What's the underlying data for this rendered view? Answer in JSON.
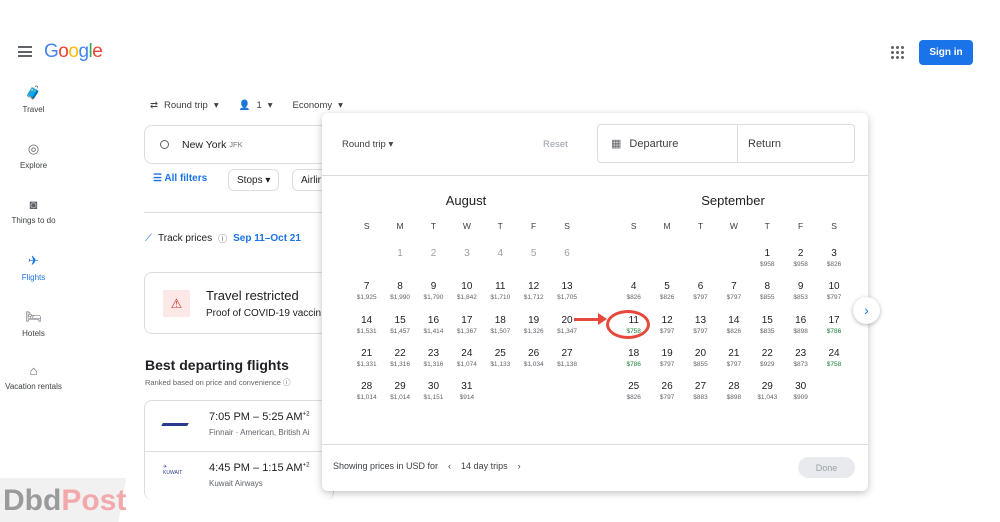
{
  "header": {
    "logo": "Google",
    "signin": "Sign in"
  },
  "nav": [
    {
      "label": "Travel",
      "icon": "luggage-icon"
    },
    {
      "label": "Explore",
      "icon": "explore-icon"
    },
    {
      "label": "Things to do",
      "icon": "camera-icon"
    },
    {
      "label": "Flights",
      "icon": "flight-icon",
      "active": true
    },
    {
      "label": "Hotels",
      "icon": "hotel-icon"
    },
    {
      "label": "Vacation rentals",
      "icon": "house-icon"
    }
  ],
  "search": {
    "trip_type": "Round trip",
    "passengers": "1",
    "cabin": "Economy",
    "origin": "New York",
    "origin_code": "JFK",
    "all_filters": "All filters",
    "stops": "Stops",
    "airlines": "Airlir"
  },
  "track": {
    "label": "Track prices",
    "dates": "Sep 11–Oct 21"
  },
  "restriction": {
    "title": "Travel restricted",
    "text": "Proof of COVID-19 vaccin"
  },
  "best": {
    "title": "Best departing flights",
    "subtitle": "Ranked based on price and convenience"
  },
  "flights": [
    {
      "times": "7:05 PM – 5:25 AM",
      "plus": "+2",
      "airline": "Finnair · American, British Ai"
    },
    {
      "times": "4:45 PM – 1:15 AM",
      "plus": "+2",
      "airline": "Kuwait Airways"
    }
  ],
  "popup": {
    "trip_type": "Round trip",
    "reset": "Reset",
    "departure": "Departure",
    "return": "Return",
    "footer_text": "Showing prices in USD for",
    "trip_length": "14 day trips",
    "done": "Done"
  },
  "weekdays": [
    "S",
    "M",
    "T",
    "W",
    "T",
    "F",
    "S"
  ],
  "months": [
    {
      "name": "August",
      "offset": 1,
      "past_until": 6,
      "prices": [
        "",
        "",
        "",
        "",
        "",
        "",
        "$1,925",
        "$1,990",
        "$1,790",
        "$1,842",
        "$1,710",
        "$1,712",
        "$1,705",
        "$1,531",
        "$1,457",
        "$1,414",
        "$1,367",
        "$1,507",
        "$1,326",
        "$1,347",
        "$1,331",
        "$1,316",
        "$1,316",
        "$1,074",
        "$1,133",
        "$1,034",
        "$1,138",
        "$1,014",
        "$1,014",
        "$1,151",
        "$914"
      ]
    },
    {
      "name": "September",
      "offset": 4,
      "past_until": 0,
      "prices": [
        "$958",
        "$958",
        "$826",
        "$826",
        "$826",
        "$797",
        "$797",
        "$855",
        "$853",
        "$797",
        "$758",
        "$797",
        "$797",
        "$826",
        "$835",
        "$898",
        "$786",
        "$786",
        "$797",
        "$855",
        "$797",
        "$929",
        "$873",
        "$758",
        "$826",
        "$797",
        "$883",
        "$898",
        "$1,043",
        "$909"
      ]
    }
  ],
  "low_prices": [
    "$758",
    "$786"
  ],
  "highlighted_day": "September 11",
  "colors": {
    "accent": "#1a73e8",
    "low_price": "#188038",
    "annotation": "#e8483b"
  },
  "watermark": "DbdPost"
}
